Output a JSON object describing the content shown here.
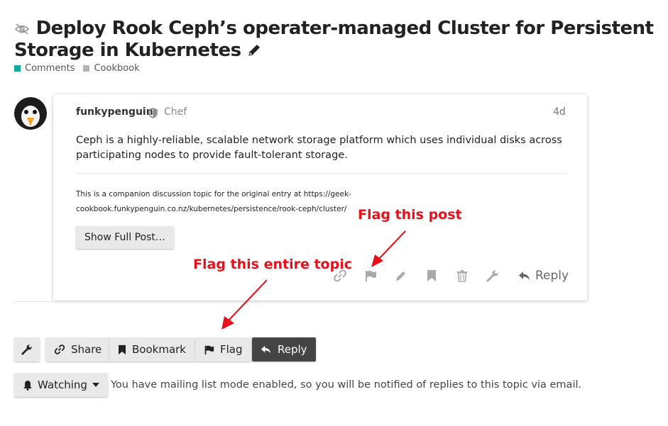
{
  "topic": {
    "title": "Deploy Rook Ceph’s operater-managed Cluster for Persistent Storage in Kubernetes",
    "categories": [
      {
        "name": "Comments",
        "color": "#12a89d"
      },
      {
        "name": "Cookbook",
        "color": "#b3b3b3"
      }
    ]
  },
  "post": {
    "username": "funkypenguin",
    "role": "Chef",
    "age": "4d",
    "body_link": "Ceph",
    "body_rest": " is a highly-reliable, scalable network storage platform which uses individual disks across participating nodes to provide fault-tolerant storage.",
    "companion_text": "This is a companion discussion topic for the original entry at ",
    "companion_url": "https://geek-cookbook.funkypenguin.co.nz/kubernetes/persistence/rook-ceph/cluster/",
    "show_full_label": "Show Full Post…",
    "actions": [
      "link-icon",
      "flag-icon",
      "pencil-icon",
      "bookmark-icon",
      "trash-icon",
      "wrench-icon"
    ],
    "reply_label": "Reply"
  },
  "annotations": {
    "flag_post": "Flag this post",
    "flag_topic": "Flag this entire topic",
    "color": "#e8101a"
  },
  "footer": {
    "share_label": "Share",
    "bookmark_label": "Bookmark",
    "flag_label": "Flag",
    "reply_label": "Reply",
    "watching_label": "Watching",
    "notify_text": "You have mailing list mode enabled, so you will be notified of replies to this topic via email."
  }
}
